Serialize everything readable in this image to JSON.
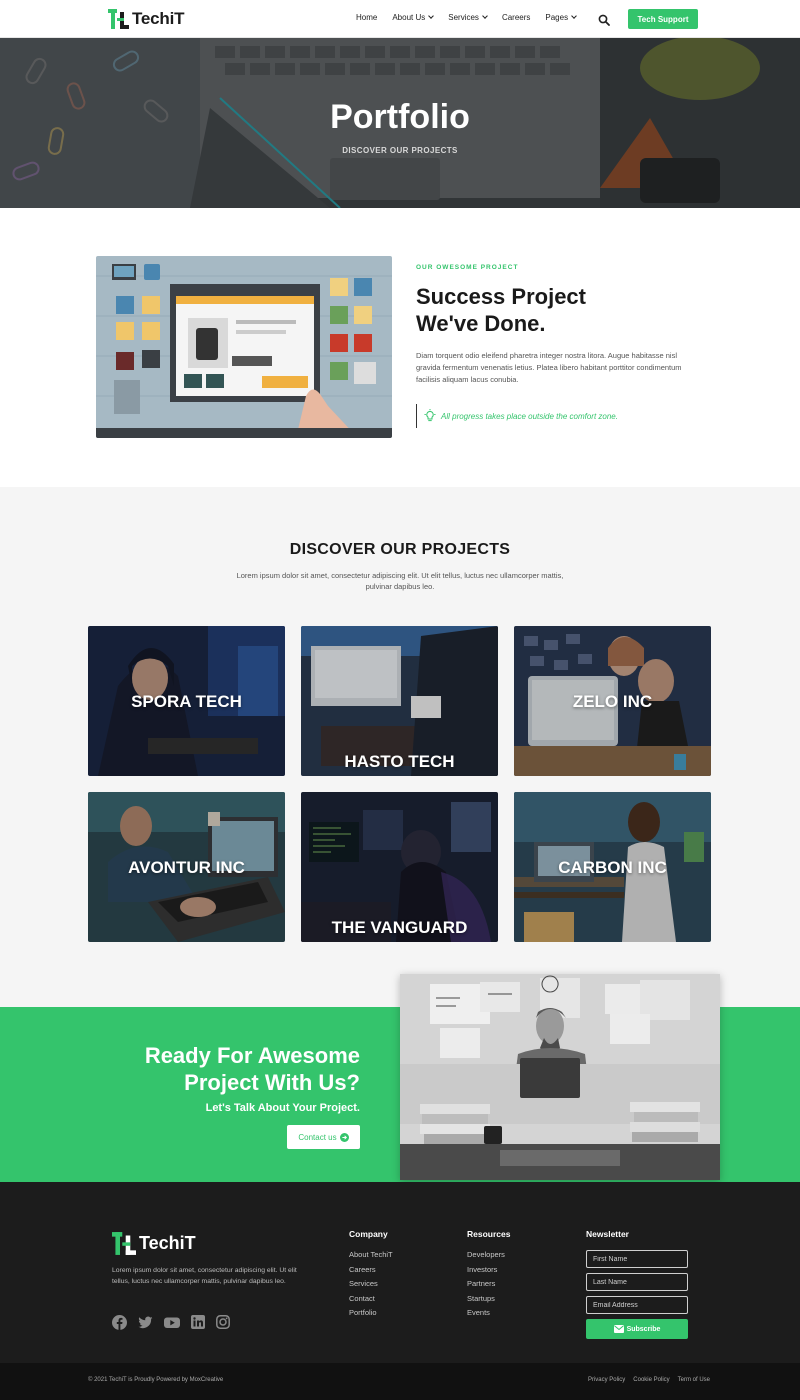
{
  "brand": {
    "name": "TechiT",
    "accent": "#34c46c",
    "dark": "#1c1c1c"
  },
  "nav": {
    "items": [
      {
        "label": "Home",
        "has_dropdown": false
      },
      {
        "label": "About Us",
        "has_dropdown": true
      },
      {
        "label": "Services",
        "has_dropdown": true
      },
      {
        "label": "Careers",
        "has_dropdown": false
      },
      {
        "label": "Pages",
        "has_dropdown": true
      }
    ],
    "search_icon": "search-icon",
    "cta_label": "Tech Support"
  },
  "hero": {
    "title": "Portfolio",
    "subtitle": "DISCOVER OUR PROJECTS"
  },
  "intro": {
    "eyebrow": "OUR OWESOME PROJECT",
    "title_line1": "Success Project",
    "title_line2": "We've Done.",
    "body": "Diam torquent odio eleifend pharetra integer nostra litora. Augue habitasse nisl gravida fermentum venenatis letius. Platea libero habitant porttitor condimentum facilisis aliquam lacus conubia.",
    "quote_icon": "lightbulb-icon",
    "quote": "All progress takes place outside the comfort zone."
  },
  "projects": {
    "title": "DISCOVER OUR PROJECTS",
    "description": "Lorem ipsum dolor sit amet, consectetur adipiscing elit. Ut elit tellus, luctus nec ullamcorper mattis, pulvinar dapibus leo.",
    "cards": [
      {
        "label": "SPORA TECH"
      },
      {
        "label": "HASTO TECH"
      },
      {
        "label": "ZELO INC"
      },
      {
        "label": "AVONTUR INC"
      },
      {
        "label": "THE VANGUARD"
      },
      {
        "label": "CARBON INC"
      }
    ]
  },
  "ready": {
    "title_line1": "Ready For Awesome",
    "title_line2": "Project With Us?",
    "subtitle": "Let's Talk About Your Project.",
    "button_label": "Contact us",
    "button_icon": "arrow-right-circle-icon"
  },
  "footer": {
    "logo_text": "TechiT",
    "description": "Lorem ipsum dolor sit amet, consectetur adipiscing elit. Ut elit tellus, luctus nec ullamcorper mattis, pulvinar dapibus leo.",
    "social_icons": [
      "facebook-icon",
      "twitter-icon",
      "youtube-icon",
      "linkedin-icon",
      "instagram-icon"
    ],
    "company": {
      "heading": "Company",
      "links": [
        "About TechiT",
        "Careers",
        "Services",
        "Contact",
        "Portfolio"
      ]
    },
    "resources": {
      "heading": "Resources",
      "links": [
        "Developers",
        "Investors",
        "Partners",
        "Startups",
        "Events"
      ]
    },
    "newsletter": {
      "heading": "Newsletter",
      "first_name_placeholder": "First Name",
      "last_name_placeholder": "Last Name",
      "email_placeholder": "Email Address",
      "button_label": "Subscribe",
      "button_icon": "envelope-icon"
    }
  },
  "bottom": {
    "copyright": "© 2021 TechiT is Proudly Powered by MoxCreative",
    "links": [
      "Privacy Policy",
      "Cookie Policy",
      "Term of Use"
    ]
  }
}
